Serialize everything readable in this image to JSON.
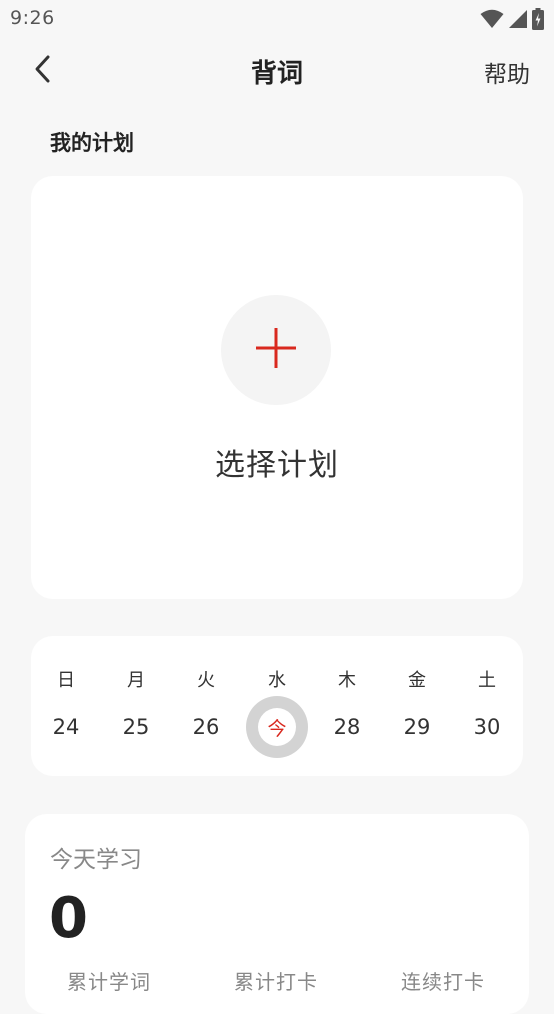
{
  "status_bar": {
    "time": "9:26",
    "icons": [
      "wifi-icon",
      "signal-icon",
      "battery-charging-icon"
    ]
  },
  "nav": {
    "title": "背词",
    "help_label": "帮助",
    "back_icon": "chevron-left-icon"
  },
  "plan_section": {
    "title": "我的计划",
    "select_label": "选择计划",
    "add_icon": "plus-icon",
    "accent_color": "#d9281e"
  },
  "calendar": {
    "weekdays": [
      "日",
      "月",
      "火",
      "水",
      "木",
      "金",
      "土"
    ],
    "dates": [
      "24",
      "25",
      "26",
      "今",
      "28",
      "29",
      "30"
    ],
    "today_index": 3
  },
  "stats": {
    "title": "今天学习",
    "today_words": "0",
    "labels": [
      "累计学词",
      "累计打卡",
      "连续打卡"
    ]
  }
}
